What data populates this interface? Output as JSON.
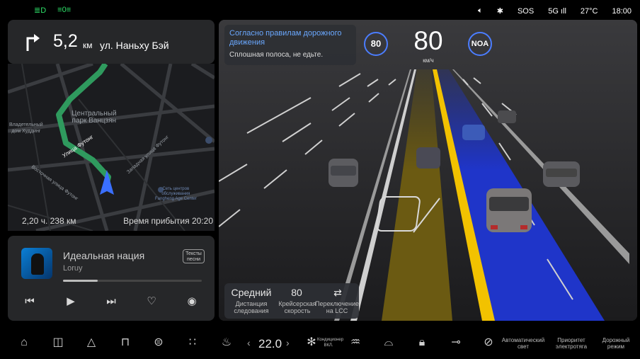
{
  "status_bar": {
    "left_icons": [
      "headlight-icon",
      "parking-light-icon"
    ],
    "sos": "SOS",
    "network": "5G",
    "temperature": "27°C",
    "time": "18:00"
  },
  "navigation": {
    "distance": "5,2",
    "distance_unit": "км",
    "street": "ул. Наньху Бэй",
    "map_labels": {
      "park": "Центральный\nпарк Ванцзян",
      "owner_house": "Владетельный\nдом Худдинг",
      "street_futong": "Улица Футонг",
      "street_west": "Западная улица Футонг",
      "street_east": "Восточная улица Футонг",
      "service": "Сеть центров\nобслуживания\nFangheng Age Center"
    },
    "remaining": "2,20 ч. 238 км",
    "arrival": "Время прибытия 20:20"
  },
  "music": {
    "title": "Идеальная нация",
    "artist": "Loruy",
    "lyrics_label": "Тексты песни",
    "progress_percent": 25
  },
  "drive": {
    "notice_title": "Согласно правилам дорожного движения",
    "notice_text": "Сплошная полоса, не едьте.",
    "speed_limit": "80",
    "speed": "80",
    "speed_unit": "км/ч",
    "mode_badge": "NOA",
    "acc": {
      "distance_value": "Средний",
      "distance_label": "Дистанция следования",
      "cruise_value": "80",
      "cruise_label": "Крейсерская скорость",
      "lcc_label": "Переключение на LCC"
    },
    "colors": {
      "ego_lane": "#1f35c9",
      "adjacent_lane": "#6b5a12",
      "solid_line": "#f2c200"
    }
  },
  "dock": {
    "temperature": "22.0",
    "ac_label": "Кондиционер ВКЛ.",
    "auto_light": "Автоматический свет",
    "ev_priority": "Приоритет электротяга",
    "road_mode": "Дорожный режим"
  }
}
